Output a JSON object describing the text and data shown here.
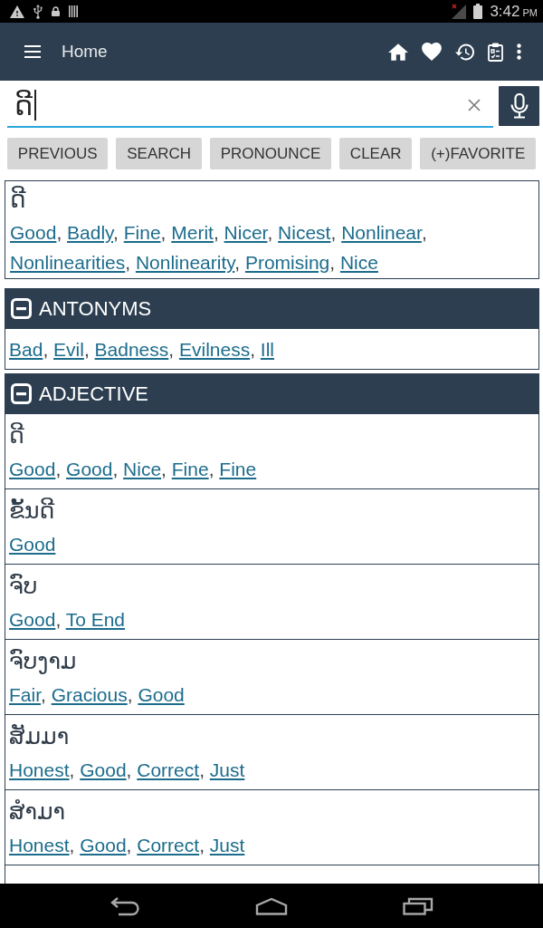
{
  "status_bar": {
    "time": "3:42",
    "meridiem": "PM"
  },
  "app_bar": {
    "title": "Home"
  },
  "search": {
    "value": "ດີ"
  },
  "buttons": [
    "PREVIOUS",
    "SEARCH",
    "PRONOUNCE",
    "CLEAR",
    "(+)FAVORITE"
  ],
  "separator": ", ",
  "result": {
    "word": "ດີ",
    "translations": [
      "Good",
      "Badly",
      "Fine",
      "Merit",
      "Nicer",
      "Nicest",
      "Nonlinear",
      "Nonlinearities",
      "Nonlinearity",
      "Promising",
      "Nice"
    ]
  },
  "sections": [
    {
      "title": "ANTONYMS",
      "expanded": true,
      "entries": [
        {
          "translations": [
            "Bad",
            "Evil",
            "Badness",
            "Evilness",
            "Ill"
          ]
        }
      ]
    },
    {
      "title": "ADJECTIVE",
      "expanded": true,
      "entries": [
        {
          "word": "ດີ",
          "translations": [
            "Good",
            "Good",
            "Nice",
            "Fine",
            "Fine"
          ]
        },
        {
          "word": "ຂັ້ນດີ",
          "translations": [
            "Good"
          ]
        },
        {
          "word": "ຈົບ",
          "translations": [
            "Good",
            "To End"
          ]
        },
        {
          "word": "ຈົບງາມ",
          "translations": [
            "Fair",
            "Gracious",
            "Good"
          ]
        },
        {
          "word": "ສັມມາ",
          "translations": [
            "Honest",
            "Good",
            "Correct",
            "Just"
          ]
        },
        {
          "word": "ສຳມາ",
          "translations": [
            "Honest",
            "Good",
            "Correct",
            "Just"
          ]
        }
      ]
    }
  ]
}
